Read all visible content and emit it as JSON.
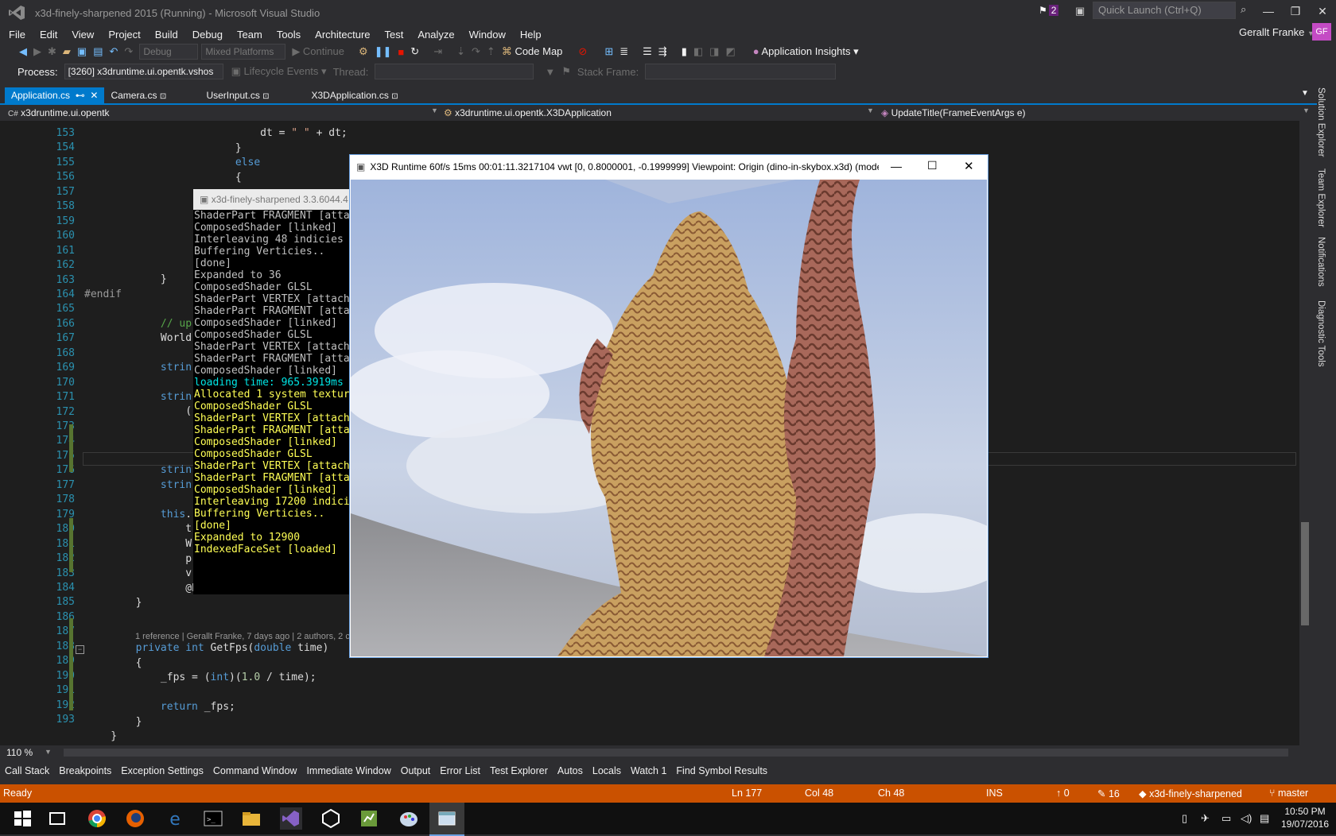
{
  "window": {
    "title": "x3d-finely-sharpened 2015 (Running) - Microsoft Visual Studio",
    "notification_count": "2",
    "quick_launch_placeholder": "Quick Launch (Ctrl+Q)",
    "user": "Gerallt Franke",
    "user_initials": "GF"
  },
  "menu": [
    "File",
    "Edit",
    "View",
    "Project",
    "Build",
    "Debug",
    "Team",
    "Tools",
    "Architecture",
    "Test",
    "Analyze",
    "Window",
    "Help"
  ],
  "toolbar1": {
    "config": "Debug",
    "platform": "Mixed Platforms",
    "continue": "Continue",
    "code_map": "Code Map",
    "app_insights": "Application Insights"
  },
  "toolbar2": {
    "process_label": "Process:",
    "process_value": "[3260] x3druntime.ui.opentk.vshos",
    "lifecycle": "Lifecycle Events",
    "thread_label": "Thread:",
    "stack_frame_label": "Stack Frame:"
  },
  "tabs": [
    "Application.cs",
    "Camera.cs",
    "UserInput.cs",
    "X3DApplication.cs"
  ],
  "navbar": {
    "project": "x3druntime.ui.opentk",
    "class": "x3druntime.ui.opentk.X3DApplication",
    "member": "UpdateTitle(FrameEventArgs e)"
  },
  "editor": {
    "zoom": "110 %",
    "lens": "1 reference | Gerallt Franke, 7 days ago | 2 authors, 2 c",
    "line_numbers": [
      "153",
      "154",
      "155",
      "156",
      "157",
      "158",
      "159",
      "160",
      "161",
      "162",
      "163",
      "164",
      "165",
      "166",
      "167",
      "168",
      "169",
      "170",
      "171",
      "172",
      "173",
      "174",
      "175",
      "176",
      "177",
      "178",
      "179",
      "180",
      "181",
      "182",
      "183",
      "184",
      "185",
      "186",
      "187",
      "188",
      "189",
      "190",
      "191",
      "192",
      "193"
    ]
  },
  "console": {
    "title": "x3d-finely-sharpened 3.3.6044.4",
    "lines": [
      {
        "text": "ShaderPart FRAGMENT [atta",
        "color": "white"
      },
      {
        "text": "ComposedShader [linked]",
        "color": "white"
      },
      {
        "text": "Interleaving 48 indicies",
        "color": "white"
      },
      {
        "text": "Buffering Verticies..",
        "color": "white"
      },
      {
        "text": "[done]",
        "color": "white"
      },
      {
        "text": "Expanded to 36",
        "color": "white"
      },
      {
        "text": "ComposedShader GLSL",
        "color": "white"
      },
      {
        "text": "ShaderPart VERTEX [attach",
        "color": "white"
      },
      {
        "text": "ShaderPart FRAGMENT [atta",
        "color": "white"
      },
      {
        "text": "ComposedShader [linked]",
        "color": "white"
      },
      {
        "text": "ComposedShader GLSL",
        "color": "white"
      },
      {
        "text": "ShaderPart VERTEX [attach",
        "color": "white"
      },
      {
        "text": "ShaderPart FRAGMENT [atta",
        "color": "white"
      },
      {
        "text": "ComposedShader [linked]",
        "color": "white"
      },
      {
        "text": "loading time: 965.3919ms",
        "color": "cyan"
      },
      {
        "text": "Allocated 1 system textur",
        "color": "yellow"
      },
      {
        "text": "ComposedShader GLSL",
        "color": "yellow"
      },
      {
        "text": "ShaderPart VERTEX [attach",
        "color": "yellow"
      },
      {
        "text": "ShaderPart FRAGMENT [atta",
        "color": "yellow"
      },
      {
        "text": "ComposedShader [linked]",
        "color": "yellow"
      },
      {
        "text": "ComposedShader GLSL",
        "color": "yellow"
      },
      {
        "text": "ShaderPart VERTEX [attach",
        "color": "yellow"
      },
      {
        "text": "ShaderPart FRAGMENT [atta",
        "color": "yellow"
      },
      {
        "text": "ComposedShader [linked]",
        "color": "yellow"
      },
      {
        "text": "Interleaving 17200 indici",
        "color": "yellow"
      },
      {
        "text": "Buffering Verticies..",
        "color": "yellow"
      },
      {
        "text": "[done]",
        "color": "yellow"
      },
      {
        "text": "Expanded to 12900",
        "color": "yellow"
      },
      {
        "text": "IndexedFaceSet [loaded]",
        "color": "yellow"
      }
    ]
  },
  "x3d_window": {
    "title": "X3D Runtime 60f/s 15ms 00:01:11.3217104 vwt [0, 0.8000001, -0.1999999] Viewpoint: Origin (dino-in-skybox.x3d) (mode..."
  },
  "tool_tabs": [
    "Call Stack",
    "Breakpoints",
    "Exception Settings",
    "Command Window",
    "Immediate Window",
    "Output",
    "Error List",
    "Test Explorer",
    "Autos",
    "Locals",
    "Watch 1",
    "Find Symbol Results"
  ],
  "status": {
    "ready": "Ready",
    "ln": "Ln 177",
    "col": "Col 48",
    "ch": "Ch 48",
    "ins": "INS",
    "up_count": "0",
    "edit_count": "16",
    "repo": "x3d-finely-sharpened",
    "branch": "master"
  },
  "side_tabs": [
    "Solution Explorer",
    "Team Explorer",
    "Notifications",
    "Diagnostic Tools"
  ],
  "clock": {
    "time": "10:50 PM",
    "date": "19/07/2016"
  },
  "colors": {
    "accent": "#007acc",
    "status_bar": "#ca5100",
    "editor_bg": "#1e1e1e"
  }
}
